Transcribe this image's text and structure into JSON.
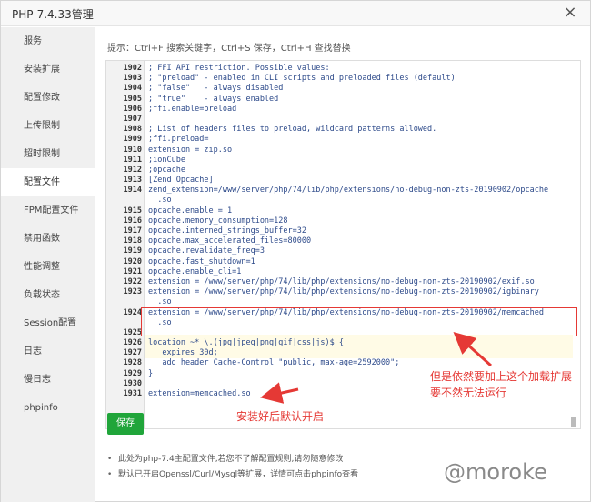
{
  "window": {
    "title": "PHP-7.4.33管理",
    "close_label": "×"
  },
  "sidebar": {
    "items": [
      {
        "label": "服务",
        "active": false
      },
      {
        "label": "安装扩展",
        "active": false
      },
      {
        "label": "配置修改",
        "active": false
      },
      {
        "label": "上传限制",
        "active": false
      },
      {
        "label": "超时限制",
        "active": false
      },
      {
        "label": "配置文件",
        "active": true
      },
      {
        "label": "FPM配置文件",
        "active": false
      },
      {
        "label": "禁用函数",
        "active": false
      },
      {
        "label": "性能调整",
        "active": false
      },
      {
        "label": "负载状态",
        "active": false
      },
      {
        "label": "Session配置",
        "active": false
      },
      {
        "label": "日志",
        "active": false
      },
      {
        "label": "慢日志",
        "active": false
      },
      {
        "label": "phpinfo",
        "active": false
      }
    ]
  },
  "tip": "提示：Ctrl+F 搜索关键字，Ctrl+S 保存，Ctrl+H 查找替换",
  "editor": {
    "lines": [
      {
        "n": "1902",
        "t": "; FFI API restriction. Possible values:"
      },
      {
        "n": "1903",
        "t": "; \"preload\" - enabled in CLI scripts and preloaded files (default)"
      },
      {
        "n": "1904",
        "t": "; \"false\"   - always disabled"
      },
      {
        "n": "1905",
        "t": "; \"true\"    - always enabled"
      },
      {
        "n": "1906",
        "t": ";ffi.enable=preload"
      },
      {
        "n": "1907",
        "t": ""
      },
      {
        "n": "1908",
        "t": "; List of headers files to preload, wildcard patterns allowed."
      },
      {
        "n": "1909",
        "t": ";ffi.preload="
      },
      {
        "n": "1910",
        "t": "extension = zip.so"
      },
      {
        "n": "1911",
        "t": ";ionCube"
      },
      {
        "n": "1912",
        "t": ";opcache"
      },
      {
        "n": "1913",
        "t": "[Zend Opcache]"
      },
      {
        "n": "1914",
        "t": "zend_extension=/www/server/php/74/lib/php/extensions/no-debug-non-zts-20190902/opcache"
      },
      {
        "n": "",
        "t": "  .so"
      },
      {
        "n": "1915",
        "t": "opcache.enable = 1"
      },
      {
        "n": "1916",
        "t": "opcache.memory_consumption=128"
      },
      {
        "n": "1917",
        "t": "opcache.interned_strings_buffer=32"
      },
      {
        "n": "1918",
        "t": "opcache.max_accelerated_files=80000"
      },
      {
        "n": "1919",
        "t": "opcache.revalidate_freq=3"
      },
      {
        "n": "1920",
        "t": "opcache.fast_shutdown=1"
      },
      {
        "n": "1921",
        "t": "opcache.enable_cli=1"
      },
      {
        "n": "1922",
        "t": "extension = /www/server/php/74/lib/php/extensions/no-debug-non-zts-20190902/exif.so"
      },
      {
        "n": "1923",
        "t": "extension = /www/server/php/74/lib/php/extensions/no-debug-non-zts-20190902/igbinary"
      },
      {
        "n": "",
        "t": "  .so"
      },
      {
        "n": "1924",
        "t": "extension = /www/server/php/74/lib/php/extensions/no-debug-non-zts-20190902/memcached"
      },
      {
        "n": "",
        "t": "  .so"
      },
      {
        "n": "1925",
        "t": ""
      },
      {
        "n": "1926",
        "t": "location ~* \\.(jpg|jpeg|png|gif|css|js)$ {"
      },
      {
        "n": "1927",
        "t": "   expires 30d;"
      },
      {
        "n": "1928",
        "t": "   add_header Cache-Control \"public, max-age=2592000\";"
      },
      {
        "n": "1929",
        "t": "}"
      },
      {
        "n": "1930",
        "t": ""
      },
      {
        "n": "1931",
        "t": "extension=memcached.so"
      }
    ]
  },
  "save_label": "保存",
  "notes": [
    "此处为php-7.4主配置文件,若您不了解配置规则,请勿随意修改",
    "默认已开启Openssl/Curl/Mysql等扩展，详情可点击phpinfo查看"
  ],
  "annotations": {
    "right_line1": "但是依然要加上这个加载扩展",
    "right_line2": "要不然无法运行",
    "bottom": "安装好后默认开启"
  },
  "watermark": "@moroke",
  "colors": {
    "accent_green": "#20a53a",
    "annotation_red": "#e53935"
  }
}
